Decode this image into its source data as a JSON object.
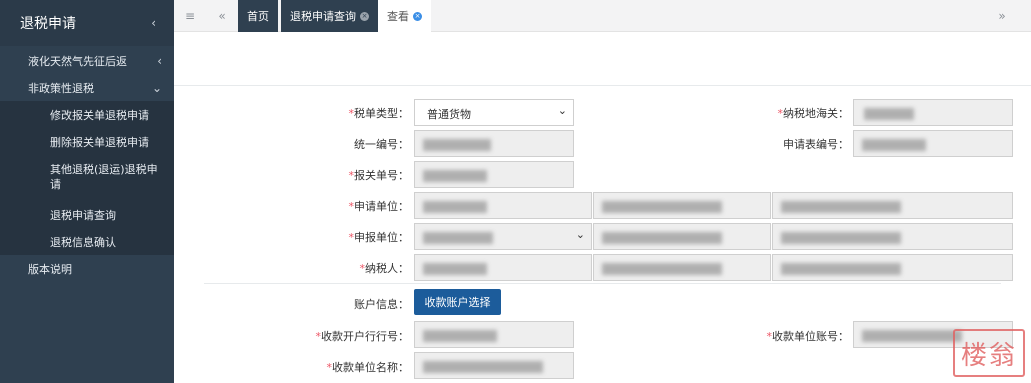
{
  "sidebar": {
    "title": "退税申请",
    "items": [
      {
        "label": "液化天然气先征后返",
        "icon": "chevron-left-icon"
      },
      {
        "label": "非政策性退税",
        "icon": "chevron-down-icon"
      }
    ],
    "subitems": [
      {
        "label": "修改报关单退税申请"
      },
      {
        "label": "删除报关单退税申请"
      },
      {
        "label": "其他退税(退运)退税申请"
      },
      {
        "label": "退税申请查询"
      },
      {
        "label": "退税信息确认"
      }
    ],
    "bottom_item": {
      "label": "版本说明"
    }
  },
  "tabbar": {
    "menu_icon": "hamburger-icon",
    "back_icon": "double-left-arrow-icon",
    "forward_icon": "double-right-arrow-icon",
    "tabs": [
      {
        "label": "首页"
      },
      {
        "label": "退税申请查询"
      },
      {
        "label": "查看"
      }
    ]
  },
  "form": {
    "tax_type_label": "税单类型：",
    "tax_type_value": "普通货物",
    "customs_label": "纳税地海关：",
    "unified_no_label": "统一编号：",
    "application_no_label": "申请表编号：",
    "declaration_no_label": "报关单号：",
    "applicant_label": "申请单位：",
    "declarant_label": "申报单位：",
    "taxpayer_label": "纳税人：",
    "account_info_label": "账户信息：",
    "account_select_button": "收款账户选择",
    "bank_label": "收款开户行行号：",
    "receiver_account_label": "收款单位账号：",
    "receiver_name_label": "收款单位名称："
  },
  "watermark": "楼翁",
  "colors": {
    "sidebar_bg": "#2f4050",
    "primary_button": "#1c5c9b",
    "required_mark": "#ed5565"
  }
}
